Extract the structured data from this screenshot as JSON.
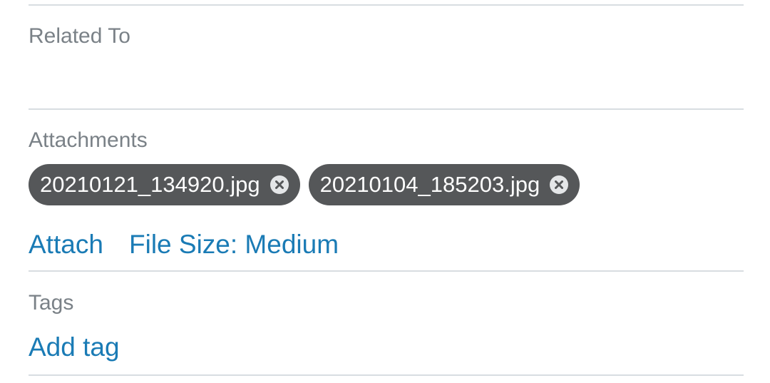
{
  "colors": {
    "label": "#7a8187",
    "link": "#1a7bb5",
    "chip_bg": "#555759",
    "chip_text": "#ffffff",
    "chip_remove_bg": "#e4e6e8",
    "chip_remove_x": "#555759",
    "divider": "#d8dde1"
  },
  "related_to": {
    "label": "Related To"
  },
  "attachments": {
    "label": "Attachments",
    "files": [
      {
        "name": "20210121_134920.jpg",
        "remove_icon": "close-circle-icon"
      },
      {
        "name": "20210104_185203.jpg",
        "remove_icon": "close-circle-icon"
      }
    ],
    "attach_label": "Attach",
    "file_size_label": "File Size: Medium"
  },
  "tags": {
    "label": "Tags",
    "add_label": "Add tag"
  }
}
